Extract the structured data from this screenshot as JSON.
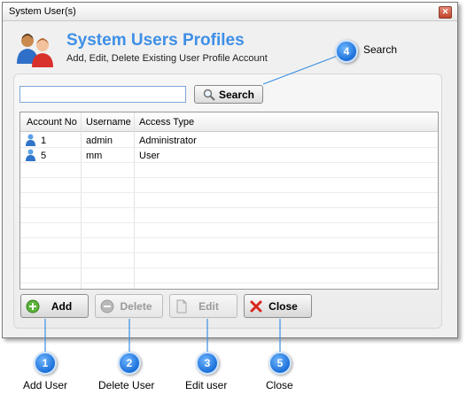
{
  "window": {
    "title": "System User(s)",
    "close_glyph": "✕"
  },
  "header": {
    "title": "System Users Profiles",
    "subtitle": "Add, Edit, Delete Existing User Profile Account",
    "icon": "users-icon"
  },
  "search": {
    "value": "",
    "button_label": "Search",
    "icon": "magnifier-icon"
  },
  "table": {
    "columns": [
      "Account No",
      "Username",
      "Access Type"
    ],
    "rows": [
      {
        "account_no": "1",
        "username": "admin",
        "access_type": "Administrator",
        "icon": "user-icon"
      },
      {
        "account_no": "5",
        "username": "mm",
        "access_type": "User",
        "icon": "user-icon"
      }
    ]
  },
  "buttons": {
    "add": {
      "label": "Add",
      "enabled": true,
      "icon": "plus-icon"
    },
    "delete": {
      "label": "Delete",
      "enabled": false,
      "icon": "minus-icon"
    },
    "edit": {
      "label": "Edit",
      "enabled": false,
      "icon": "document-icon"
    },
    "close": {
      "label": "Close",
      "enabled": true,
      "icon": "x-icon"
    }
  },
  "callouts": [
    {
      "number": "4",
      "label": "Search"
    },
    {
      "number": "1",
      "label": "Add User"
    },
    {
      "number": "2",
      "label": "Delete User"
    },
    {
      "number": "3",
      "label": "Edit user"
    },
    {
      "number": "5",
      "label": "Close"
    }
  ],
  "colors": {
    "accent": "#3f8fe6",
    "badge": "#1a6fd8",
    "close_red": "#d8261c"
  }
}
